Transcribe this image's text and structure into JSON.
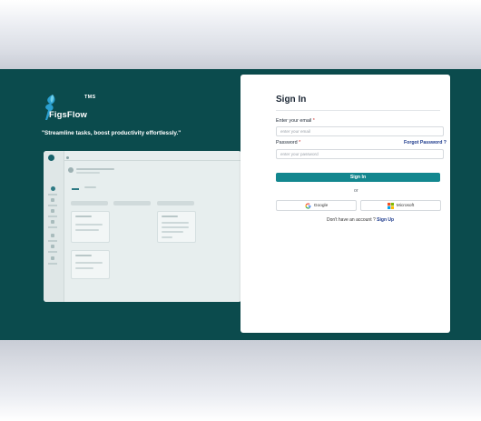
{
  "brand": {
    "badge": "TMS",
    "name": "FigsFlow"
  },
  "tagline": "\"Streamline tasks, boost productivity effortlessly.\"",
  "signin": {
    "title": "Sign In",
    "email_label": "Enter your email",
    "required_mark": "*",
    "email_placeholder": "enter your email",
    "password_label": "Password",
    "forgot_label": "Forgot Password ?",
    "password_placeholder": "enter your password",
    "submit_label": "Sign In",
    "or_text": "or",
    "google_label": "Google",
    "microsoft_label": "Microsoft",
    "no_account_text": "Don't have an account ?",
    "signup_label": "Sign Up"
  },
  "colors": {
    "hero_bg": "#0b4b4d",
    "primary_button": "#13878f",
    "link": "#1d3a8c"
  },
  "icons": [
    "figsflow-logo-icon",
    "google-icon",
    "microsoft-icon"
  ]
}
